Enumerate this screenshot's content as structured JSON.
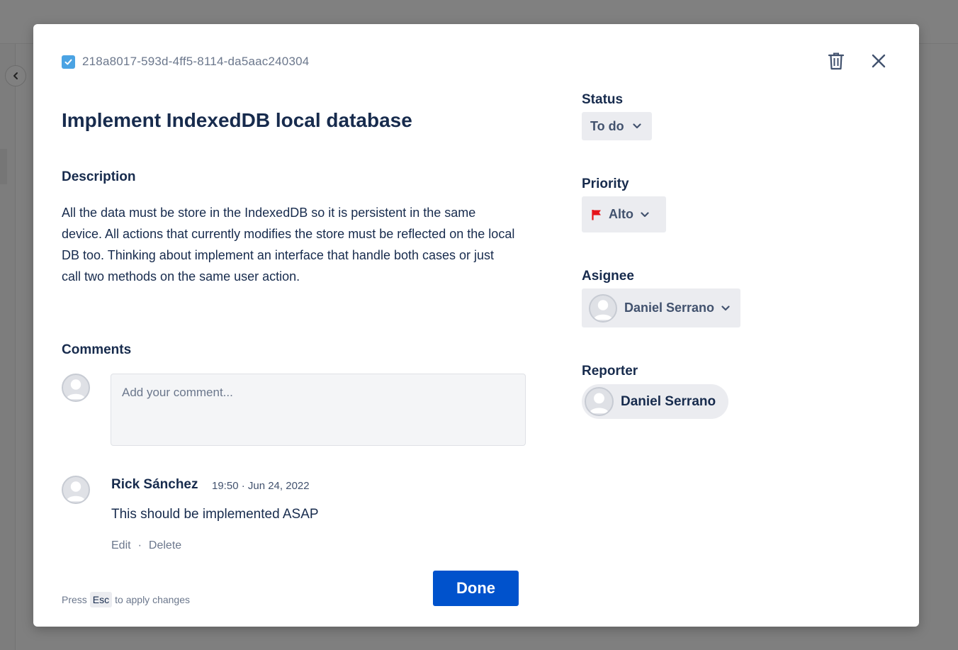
{
  "issue": {
    "key": "218a8017-593d-4ff5-8114-da5aac240304",
    "title": "Implement IndexedDB local database",
    "description_label": "Description",
    "description": "All the data must be store in the IndexedDB so it is persistent in the same device. All actions that currently modifies the store must be reflected on the local DB too. Thinking about implement an interface that handle both cases or just call two methods on the same user action."
  },
  "comments": {
    "label": "Comments",
    "input_placeholder": "Add your comment...",
    "items": [
      {
        "author": "Rick Sánchez",
        "time": "19:50 · Jun 24, 2022",
        "body": "This should be implemented ASAP",
        "edit_label": "Edit",
        "separator": "·",
        "delete_label": "Delete"
      }
    ]
  },
  "footer": {
    "hint_prefix": "Press",
    "hint_key": "Esc",
    "hint_suffix": "to apply changes",
    "done_label": "Done"
  },
  "fields": {
    "status_label": "Status",
    "status_value": "To do",
    "priority_label": "Priority",
    "priority_value": "Alto",
    "priority_color": "#e5141b",
    "asignee_label": "Asignee",
    "asignee_value": "Daniel Serrano",
    "reporter_label": "Reporter",
    "reporter_value": "Daniel Serrano"
  },
  "icons": {
    "key": "checkbox-icon",
    "delete": "trash-icon",
    "close": "close-icon",
    "collapse": "chevron-left-icon"
  },
  "colors": {
    "primary": "#0052cc",
    "text": "#172b4d",
    "muted": "#6b778c",
    "checkbox": "#4ba3e3"
  }
}
